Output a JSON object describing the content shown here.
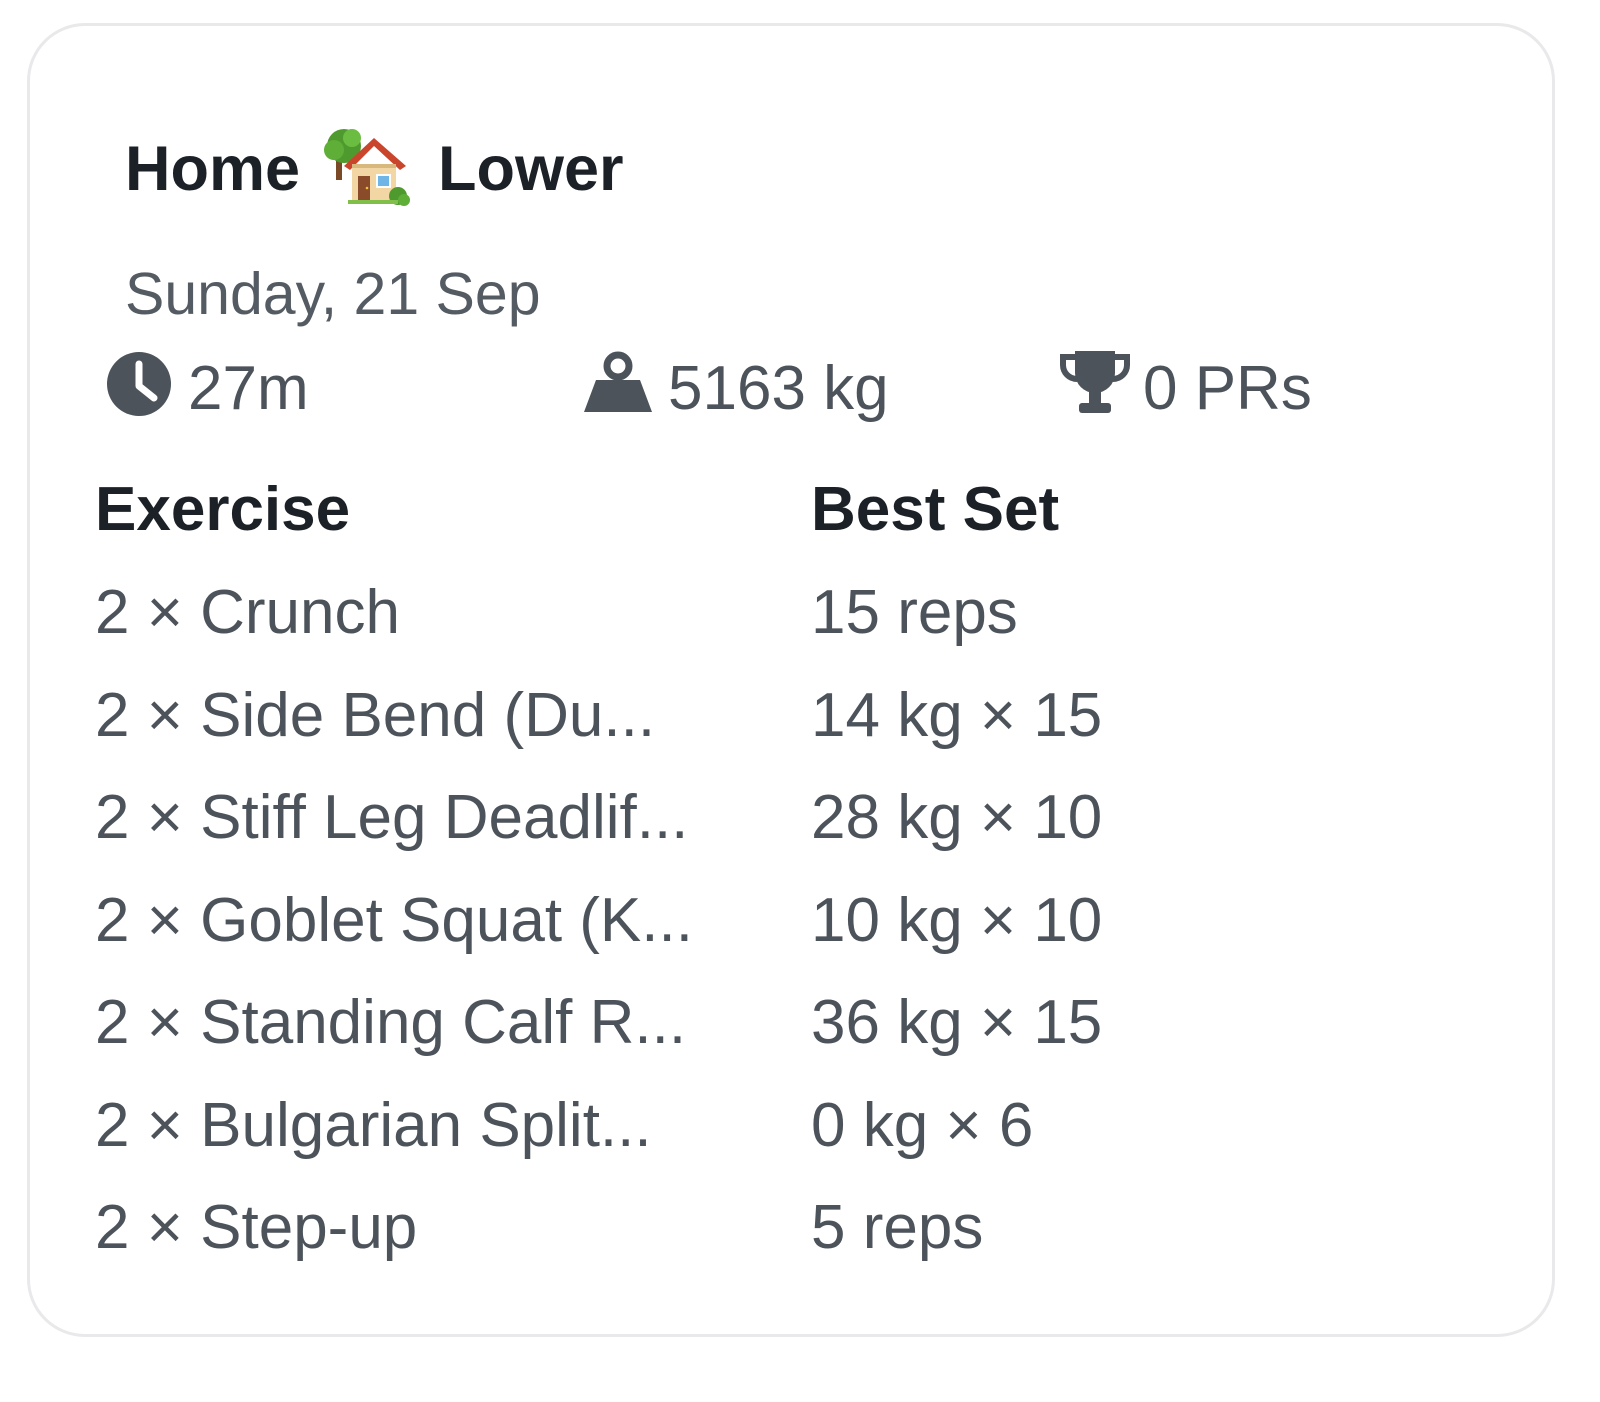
{
  "workout": {
    "title_part1": "Home",
    "title_icon": "house-with-garden-emoji",
    "title_part2": "Lower",
    "date": "Sunday, 21 Sep"
  },
  "stats": {
    "duration": {
      "icon": "clock-icon",
      "value": "27m"
    },
    "volume": {
      "icon": "weight-icon",
      "value": "5163 kg"
    },
    "prs": {
      "icon": "trophy-icon",
      "value": "0 PRs"
    }
  },
  "table": {
    "headers": {
      "exercise": "Exercise",
      "best_set": "Best Set"
    },
    "rows": [
      {
        "exercise": "2 × Crunch",
        "best_set": "15 reps"
      },
      {
        "exercise": "2 × Side Bend (Du...",
        "best_set": "14 kg × 15"
      },
      {
        "exercise": "2 × Stiff Leg Deadlif...",
        "best_set": "28 kg × 10"
      },
      {
        "exercise": "2 × Goblet Squat (K...",
        "best_set": "10 kg × 10"
      },
      {
        "exercise": "2 × Standing Calf R...",
        "best_set": "36 kg × 15"
      },
      {
        "exercise": "2 × Bulgarian Split...",
        "best_set": "0 kg × 6"
      },
      {
        "exercise": "2 × Step-up",
        "best_set": "5 reps"
      }
    ]
  },
  "colors": {
    "title_text": "#1c2128",
    "body_text": "#4c535b",
    "icon": "#4c535b",
    "card_border": "#e9e9ec"
  }
}
